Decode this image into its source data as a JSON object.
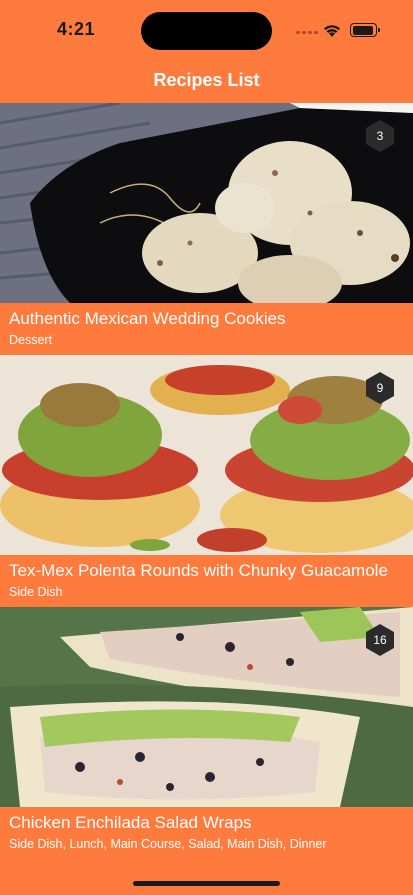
{
  "status_bar": {
    "time": "4:21"
  },
  "nav": {
    "title": "Recipes List"
  },
  "recipes": [
    {
      "title": "Authentic Mexican Wedding Cookies",
      "categories": "Dessert",
      "count": "3",
      "image": "mexican-wedding-cookies-photo"
    },
    {
      "title": "Tex-Mex Polenta Rounds with Chunky Guacamole",
      "categories": "Side Dish",
      "count": "9",
      "image": "polenta-rounds-guacamole-photo"
    },
    {
      "title": "Chicken Enchilada Salad Wraps",
      "categories": "Side Dish, Lunch, Main Course, Salad, Main Dish, Dinner",
      "count": "16",
      "image": "chicken-enchilada-wraps-photo"
    }
  ],
  "colors": {
    "accent": "#ff7a3d",
    "badge": "#2b2b2b",
    "text": "#ffffff"
  }
}
